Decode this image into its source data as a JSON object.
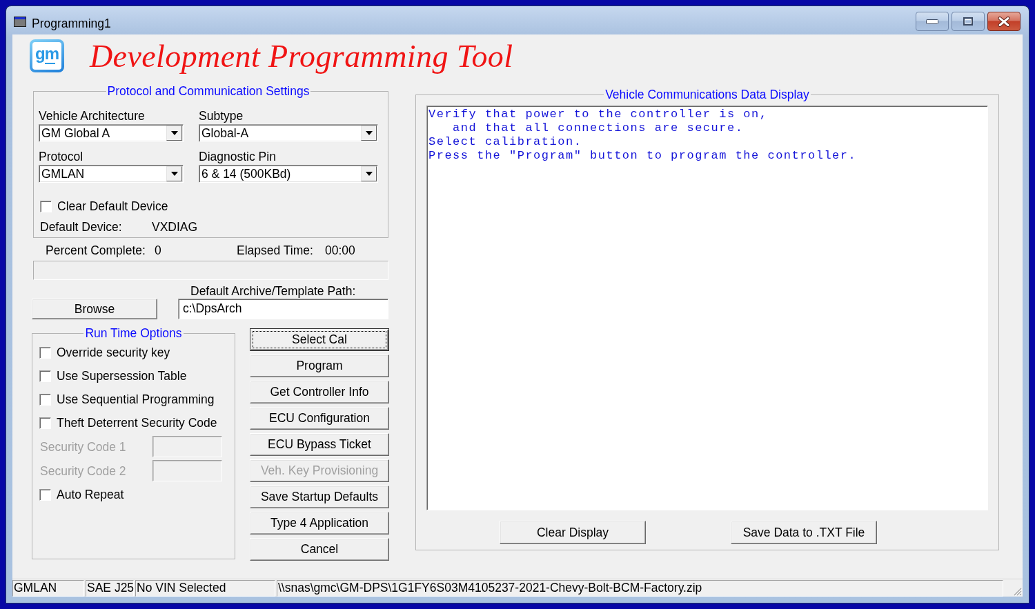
{
  "window": {
    "title": "Programming1"
  },
  "header": {
    "logo": "gm",
    "title": "Development Programming Tool"
  },
  "protocol_settings": {
    "title": "Protocol and Communication Settings",
    "dropdowns": [
      {
        "label": "Vehicle Architecture",
        "value": "GM Global A"
      },
      {
        "label": "Subtype",
        "value": "Global-A"
      },
      {
        "label": "Protocol",
        "value": "GMLAN"
      },
      {
        "label": "Diagnostic Pin",
        "value": "6 & 14 (500KBd)"
      }
    ],
    "clear_default_device": {
      "label": "Clear Default Device",
      "checked": false
    },
    "default_device": {
      "label": "Default Device:",
      "value": "VXDIAG"
    }
  },
  "progress": {
    "percent_label": "Percent Complete:",
    "percent_value": "0",
    "elapsed_label": "Elapsed Time:",
    "elapsed_value": "00:00",
    "level": 0
  },
  "archive_path": {
    "browse_button": "Browse",
    "label": "Default Archive/Template Path:",
    "value": "c:\\DpsArch"
  },
  "run_time_options": {
    "title": "Run Time Options",
    "items": [
      {
        "kind": "checkbox",
        "label": "Override security key",
        "checked": false,
        "disabled": false
      },
      {
        "kind": "checkbox",
        "label": "Use Supersession Table",
        "checked": false,
        "disabled": false
      },
      {
        "kind": "checkbox",
        "label": "Use Sequential Programming",
        "checked": false,
        "disabled": false
      },
      {
        "kind": "checkbox",
        "label": "Theft Deterrent Security Code",
        "checked": false,
        "disabled": false
      },
      {
        "kind": "field",
        "label": "Security Code 1",
        "disabled": true
      },
      {
        "kind": "field",
        "label": "Security Code 2",
        "disabled": true
      },
      {
        "kind": "checkbox",
        "label": "Auto Repeat",
        "checked": false,
        "disabled": false
      }
    ]
  },
  "actions": [
    {
      "label": "Select Cal",
      "focused": true,
      "disabled": false
    },
    {
      "label": "Program",
      "focused": false,
      "disabled": false
    },
    {
      "label": "Get Controller Info",
      "focused": false,
      "disabled": false
    },
    {
      "label": "ECU Configuration",
      "focused": false,
      "disabled": false
    },
    {
      "label": "ECU Bypass Ticket",
      "focused": false,
      "disabled": false
    },
    {
      "label": "Veh. Key Provisioning",
      "focused": false,
      "disabled": true
    },
    {
      "label": "Save Startup Defaults",
      "focused": false,
      "disabled": false
    },
    {
      "label": "Type 4 Application",
      "focused": false,
      "disabled": false
    },
    {
      "label": "Cancel",
      "focused": false,
      "disabled": false
    }
  ],
  "data_display": {
    "title": "Vehicle Communications Data Display",
    "lines": [
      "Verify that power to the controller is on,",
      "   and that all connections are secure.",
      "Select calibration.",
      "Press the \"Program\" button to program the controller."
    ],
    "buttons": [
      "Clear Display",
      "Save Data to .TXT File"
    ]
  },
  "status_bar": [
    "GMLAN",
    "SAE J25",
    "No VIN Selected",
    "\\\\snas\\gmc\\GM-DPS\\1G1FY6S03M4105237-2021-Chevy-Bolt-BCM-Factory.zip"
  ]
}
